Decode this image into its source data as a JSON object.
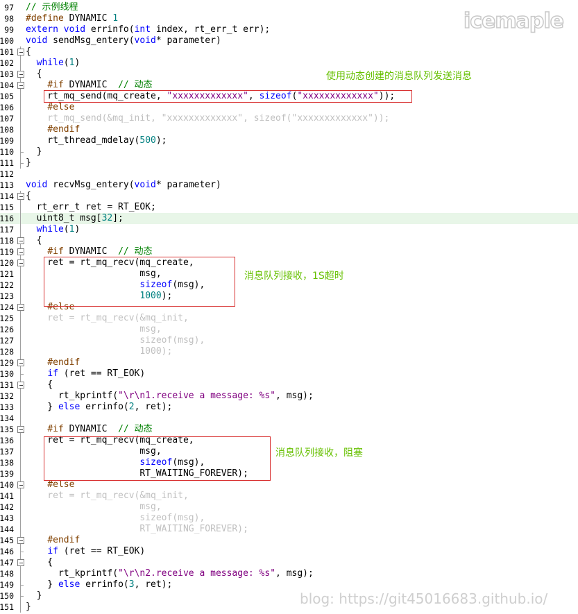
{
  "watermark": {
    "logo_text": "icemaple",
    "blog": "blog: https://git45016683.github.io/"
  },
  "annotations": {
    "send": "使用动态创建的消息队列发送消息",
    "recv_timeout": "消息队列接收，1S超时",
    "recv_block": "消息队列接收，阻塞"
  },
  "colors": {
    "keyword": "#0000ff",
    "preprocessor": "#804000",
    "string": "#800080",
    "number": "#008080",
    "comment": "#008000",
    "inactive": "#c0c0c0",
    "annotation": "#66c000",
    "highlight_box": "#d83030",
    "current_line": "#e8f6e8"
  },
  "current_line": "116",
  "lines": [
    {
      "num": "97",
      "tokens": [
        [
          "cm",
          "// 示例线程"
        ]
      ]
    },
    {
      "num": "98",
      "tokens": [
        [
          "pp",
          "#define"
        ],
        [
          "",
          " DYNAMIC "
        ],
        [
          "num",
          "1"
        ]
      ]
    },
    {
      "num": "99",
      "tokens": [
        [
          "kw",
          "extern"
        ],
        [
          "",
          " "
        ],
        [
          "kw",
          "void"
        ],
        [
          "",
          " errinfo("
        ],
        [
          "kw",
          "int"
        ],
        [
          "",
          " index, rt_err_t err);"
        ]
      ]
    },
    {
      "num": "100",
      "tokens": [
        [
          "kw",
          "void"
        ],
        [
          "",
          " sendMsg_entery("
        ],
        [
          "kw",
          "void"
        ],
        [
          "",
          "* parameter)"
        ]
      ]
    },
    {
      "num": "101",
      "tokens": [
        [
          "",
          "{"
        ]
      ]
    },
    {
      "num": "102",
      "tokens": [
        [
          "",
          "  "
        ],
        [
          "kw",
          "while"
        ],
        [
          "",
          "("
        ],
        [
          "num",
          "1"
        ],
        [
          "",
          ")"
        ]
      ]
    },
    {
      "num": "103",
      "tokens": [
        [
          "",
          "  {"
        ]
      ]
    },
    {
      "num": "104",
      "tokens": [
        [
          "",
          "    "
        ],
        [
          "pp",
          "#if"
        ],
        [
          "",
          " DYNAMIC  "
        ],
        [
          "cm",
          "// 动态"
        ]
      ]
    },
    {
      "num": "105",
      "tokens": [
        [
          "",
          "    rt_mq_send(mq_create, "
        ],
        [
          "str",
          "\"xxxxxxxxxxxxx\""
        ],
        [
          "",
          ", "
        ],
        [
          "kw",
          "sizeof"
        ],
        [
          "",
          "("
        ],
        [
          "str",
          "\"xxxxxxxxxxxxx\""
        ],
        [
          "",
          "));"
        ]
      ]
    },
    {
      "num": "106",
      "tokens": [
        [
          "",
          "    "
        ],
        [
          "pp",
          "#else"
        ]
      ]
    },
    {
      "num": "107",
      "tokens": [
        [
          "dim",
          "    rt_mq_send(&mq_init, \"xxxxxxxxxxxxx\", sizeof(\"xxxxxxxxxxxxx\"));"
        ]
      ]
    },
    {
      "num": "108",
      "tokens": [
        [
          "",
          "    "
        ],
        [
          "pp",
          "#endif"
        ]
      ]
    },
    {
      "num": "109",
      "tokens": [
        [
          "",
          "    rt_thread_mdelay("
        ],
        [
          "num",
          "500"
        ],
        [
          "",
          ");"
        ]
      ]
    },
    {
      "num": "110",
      "tokens": [
        [
          "",
          "  }"
        ]
      ]
    },
    {
      "num": "111",
      "tokens": [
        [
          "",
          "}"
        ]
      ]
    },
    {
      "num": "112",
      "tokens": []
    },
    {
      "num": "113",
      "tokens": [
        [
          "kw",
          "void"
        ],
        [
          "",
          " recvMsg_entery("
        ],
        [
          "kw",
          "void"
        ],
        [
          "",
          "* parameter)"
        ]
      ]
    },
    {
      "num": "114",
      "tokens": [
        [
          "",
          "{"
        ]
      ]
    },
    {
      "num": "115",
      "tokens": [
        [
          "",
          "  rt_err_t ret = RT_EOK;"
        ]
      ]
    },
    {
      "num": "116",
      "tokens": [
        [
          "",
          "  uint8_t msg["
        ],
        [
          "num",
          "32"
        ],
        [
          "",
          "];"
        ]
      ]
    },
    {
      "num": "117",
      "tokens": [
        [
          "",
          "  "
        ],
        [
          "kw",
          "while"
        ],
        [
          "",
          "("
        ],
        [
          "num",
          "1"
        ],
        [
          "",
          ")"
        ]
      ]
    },
    {
      "num": "118",
      "tokens": [
        [
          "",
          "  {"
        ]
      ]
    },
    {
      "num": "119",
      "tokens": [
        [
          "",
          "    "
        ],
        [
          "pp",
          "#if"
        ],
        [
          "",
          " DYNAMIC  "
        ],
        [
          "cm",
          "// 动态"
        ]
      ]
    },
    {
      "num": "120",
      "tokens": [
        [
          "",
          "    ret = rt_mq_recv(mq_create,"
        ]
      ]
    },
    {
      "num": "121",
      "tokens": [
        [
          "",
          "                     msg,"
        ]
      ]
    },
    {
      "num": "122",
      "tokens": [
        [
          "",
          "                     "
        ],
        [
          "kw",
          "sizeof"
        ],
        [
          "",
          "(msg),"
        ]
      ]
    },
    {
      "num": "123",
      "tokens": [
        [
          "",
          "                     "
        ],
        [
          "num",
          "1000"
        ],
        [
          "",
          ");"
        ]
      ]
    },
    {
      "num": "124",
      "tokens": [
        [
          "",
          "    "
        ],
        [
          "pp",
          "#else"
        ]
      ]
    },
    {
      "num": "125",
      "tokens": [
        [
          "dim",
          "    ret = rt_mq_recv(&mq_init,"
        ]
      ]
    },
    {
      "num": "126",
      "tokens": [
        [
          "dim",
          "                     msg,"
        ]
      ]
    },
    {
      "num": "127",
      "tokens": [
        [
          "dim",
          "                     sizeof(msg),"
        ]
      ]
    },
    {
      "num": "128",
      "tokens": [
        [
          "dim",
          "                     1000);"
        ]
      ]
    },
    {
      "num": "129",
      "tokens": [
        [
          "",
          "    "
        ],
        [
          "pp",
          "#endif"
        ]
      ]
    },
    {
      "num": "130",
      "tokens": [
        [
          "",
          "    "
        ],
        [
          "kw",
          "if"
        ],
        [
          "",
          " (ret == RT_EOK)"
        ]
      ]
    },
    {
      "num": "131",
      "tokens": [
        [
          "",
          "    {"
        ]
      ]
    },
    {
      "num": "132",
      "tokens": [
        [
          "",
          "      rt_kprintf("
        ],
        [
          "str",
          "\"\\r\\n1.receive a message: %s\""
        ],
        [
          "",
          ", msg);"
        ]
      ]
    },
    {
      "num": "133",
      "tokens": [
        [
          "",
          "    } "
        ],
        [
          "kw",
          "else"
        ],
        [
          "",
          " errinfo("
        ],
        [
          "num",
          "2"
        ],
        [
          "",
          ", ret);"
        ]
      ]
    },
    {
      "num": "134",
      "tokens": []
    },
    {
      "num": "135",
      "tokens": [
        [
          "",
          "    "
        ],
        [
          "pp",
          "#if"
        ],
        [
          "",
          " DYNAMIC  "
        ],
        [
          "cm",
          "// 动态"
        ]
      ]
    },
    {
      "num": "136",
      "tokens": [
        [
          "",
          "    ret = rt_mq_recv(mq_create,"
        ]
      ]
    },
    {
      "num": "137",
      "tokens": [
        [
          "",
          "                     msg,"
        ]
      ]
    },
    {
      "num": "138",
      "tokens": [
        [
          "",
          "                     "
        ],
        [
          "kw",
          "sizeof"
        ],
        [
          "",
          "(msg),"
        ]
      ]
    },
    {
      "num": "139",
      "tokens": [
        [
          "",
          "                     RT_WAITING_FOREVER);"
        ]
      ]
    },
    {
      "num": "140",
      "tokens": [
        [
          "",
          "    "
        ],
        [
          "pp",
          "#else"
        ]
      ]
    },
    {
      "num": "141",
      "tokens": [
        [
          "dim",
          "    ret = rt_mq_recv(&mq_init,"
        ]
      ]
    },
    {
      "num": "142",
      "tokens": [
        [
          "dim",
          "                     msg,"
        ]
      ]
    },
    {
      "num": "143",
      "tokens": [
        [
          "dim",
          "                     sizeof(msg),"
        ]
      ]
    },
    {
      "num": "144",
      "tokens": [
        [
          "dim",
          "                     RT_WAITING_FOREVER);"
        ]
      ]
    },
    {
      "num": "145",
      "tokens": [
        [
          "",
          "    "
        ],
        [
          "pp",
          "#endif"
        ]
      ]
    },
    {
      "num": "146",
      "tokens": [
        [
          "",
          "    "
        ],
        [
          "kw",
          "if"
        ],
        [
          "",
          " (ret == RT_EOK)"
        ]
      ]
    },
    {
      "num": "147",
      "tokens": [
        [
          "",
          "    {"
        ]
      ]
    },
    {
      "num": "148",
      "tokens": [
        [
          "",
          "      rt_kprintf("
        ],
        [
          "str",
          "\"\\r\\n2.receive a message: %s\""
        ],
        [
          "",
          ", msg);"
        ]
      ]
    },
    {
      "num": "149",
      "tokens": [
        [
          "",
          "    } "
        ],
        [
          "kw",
          "else"
        ],
        [
          "",
          " errinfo("
        ],
        [
          "num",
          "3"
        ],
        [
          "",
          ", ret);"
        ]
      ]
    },
    {
      "num": "150",
      "tokens": [
        [
          "",
          "  }"
        ]
      ]
    },
    {
      "num": "151",
      "tokens": [
        [
          "",
          "}"
        ]
      ]
    }
  ]
}
